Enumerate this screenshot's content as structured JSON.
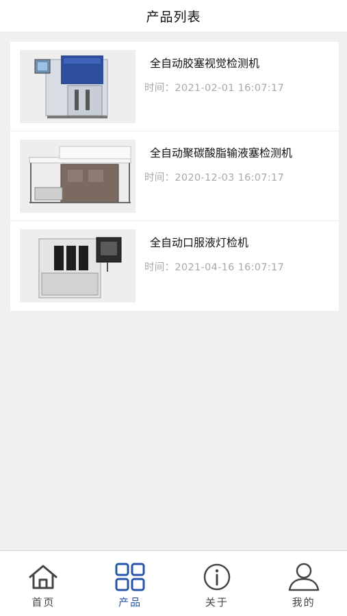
{
  "header": {
    "title": "产品列表"
  },
  "products": [
    {
      "title": "全自动胶塞视觉检测机",
      "time": "时间：2021-02-01 16:07:17",
      "image": "machine-photo-1"
    },
    {
      "title": "全自动聚碳酸脂输液塞检测机",
      "time": "时间：2020-12-03 16:07:17",
      "image": "machine-photo-2"
    },
    {
      "title": "全自动口服液灯检机",
      "time": "时间：2021-04-16 16:07:17",
      "image": "machine-photo-3"
    }
  ],
  "tabbar": {
    "tabs": [
      {
        "label": "首页",
        "icon": "home-icon",
        "active": false
      },
      {
        "label": "产品",
        "icon": "grid-icon",
        "active": true
      },
      {
        "label": "关于",
        "icon": "info-icon",
        "active": false
      },
      {
        "label": "我的",
        "icon": "user-icon",
        "active": false
      }
    ],
    "active_color": "#2553a8",
    "inactive_color": "#444444"
  }
}
